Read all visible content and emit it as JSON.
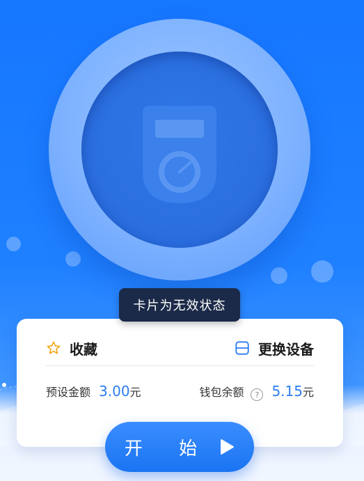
{
  "toast": {
    "message": "卡片为无效状态"
  },
  "card": {
    "favorite_label": "收藏",
    "switch_device_label": "更换设备",
    "preset_amount_label": "预设金额",
    "preset_amount_value": "3.00",
    "preset_amount_unit": "元",
    "wallet_balance_label": "钱包余额",
    "help_symbol": "?",
    "wallet_balance_value": "5.15",
    "wallet_balance_unit": "元"
  },
  "start_button": {
    "label": "开 始",
    "icon": "play-icon"
  },
  "colors": {
    "primary": "#1677ff",
    "accent_text": "#2a7df0",
    "toast_bg": "#1b2a48",
    "star": "#f3a716"
  }
}
